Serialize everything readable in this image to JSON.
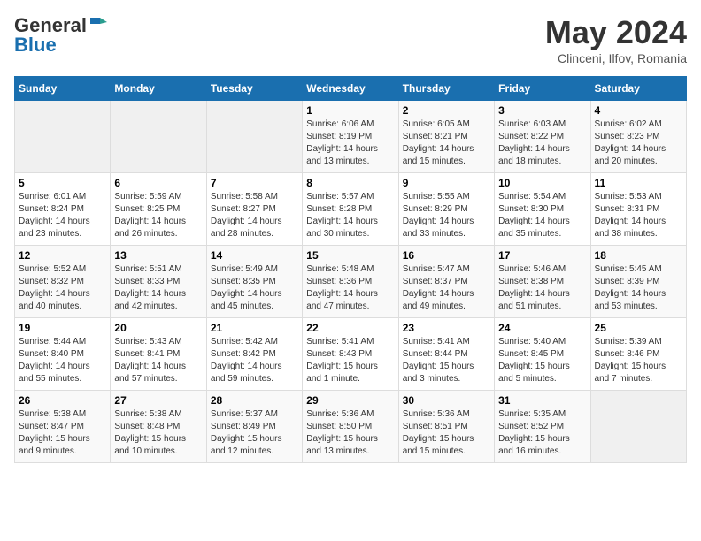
{
  "header": {
    "logo_general": "General",
    "logo_blue": "Blue",
    "title": "May 2024",
    "location": "Clinceni, Ilfov, Romania"
  },
  "weekdays": [
    "Sunday",
    "Monday",
    "Tuesday",
    "Wednesday",
    "Thursday",
    "Friday",
    "Saturday"
  ],
  "weeks": [
    [
      {
        "day": "",
        "content": ""
      },
      {
        "day": "",
        "content": ""
      },
      {
        "day": "",
        "content": ""
      },
      {
        "day": "1",
        "content": "Sunrise: 6:06 AM\nSunset: 8:19 PM\nDaylight: 14 hours\nand 13 minutes."
      },
      {
        "day": "2",
        "content": "Sunrise: 6:05 AM\nSunset: 8:21 PM\nDaylight: 14 hours\nand 15 minutes."
      },
      {
        "day": "3",
        "content": "Sunrise: 6:03 AM\nSunset: 8:22 PM\nDaylight: 14 hours\nand 18 minutes."
      },
      {
        "day": "4",
        "content": "Sunrise: 6:02 AM\nSunset: 8:23 PM\nDaylight: 14 hours\nand 20 minutes."
      }
    ],
    [
      {
        "day": "5",
        "content": "Sunrise: 6:01 AM\nSunset: 8:24 PM\nDaylight: 14 hours\nand 23 minutes."
      },
      {
        "day": "6",
        "content": "Sunrise: 5:59 AM\nSunset: 8:25 PM\nDaylight: 14 hours\nand 26 minutes."
      },
      {
        "day": "7",
        "content": "Sunrise: 5:58 AM\nSunset: 8:27 PM\nDaylight: 14 hours\nand 28 minutes."
      },
      {
        "day": "8",
        "content": "Sunrise: 5:57 AM\nSunset: 8:28 PM\nDaylight: 14 hours\nand 30 minutes."
      },
      {
        "day": "9",
        "content": "Sunrise: 5:55 AM\nSunset: 8:29 PM\nDaylight: 14 hours\nand 33 minutes."
      },
      {
        "day": "10",
        "content": "Sunrise: 5:54 AM\nSunset: 8:30 PM\nDaylight: 14 hours\nand 35 minutes."
      },
      {
        "day": "11",
        "content": "Sunrise: 5:53 AM\nSunset: 8:31 PM\nDaylight: 14 hours\nand 38 minutes."
      }
    ],
    [
      {
        "day": "12",
        "content": "Sunrise: 5:52 AM\nSunset: 8:32 PM\nDaylight: 14 hours\nand 40 minutes."
      },
      {
        "day": "13",
        "content": "Sunrise: 5:51 AM\nSunset: 8:33 PM\nDaylight: 14 hours\nand 42 minutes."
      },
      {
        "day": "14",
        "content": "Sunrise: 5:49 AM\nSunset: 8:35 PM\nDaylight: 14 hours\nand 45 minutes."
      },
      {
        "day": "15",
        "content": "Sunrise: 5:48 AM\nSunset: 8:36 PM\nDaylight: 14 hours\nand 47 minutes."
      },
      {
        "day": "16",
        "content": "Sunrise: 5:47 AM\nSunset: 8:37 PM\nDaylight: 14 hours\nand 49 minutes."
      },
      {
        "day": "17",
        "content": "Sunrise: 5:46 AM\nSunset: 8:38 PM\nDaylight: 14 hours\nand 51 minutes."
      },
      {
        "day": "18",
        "content": "Sunrise: 5:45 AM\nSunset: 8:39 PM\nDaylight: 14 hours\nand 53 minutes."
      }
    ],
    [
      {
        "day": "19",
        "content": "Sunrise: 5:44 AM\nSunset: 8:40 PM\nDaylight: 14 hours\nand 55 minutes."
      },
      {
        "day": "20",
        "content": "Sunrise: 5:43 AM\nSunset: 8:41 PM\nDaylight: 14 hours\nand 57 minutes."
      },
      {
        "day": "21",
        "content": "Sunrise: 5:42 AM\nSunset: 8:42 PM\nDaylight: 14 hours\nand 59 minutes."
      },
      {
        "day": "22",
        "content": "Sunrise: 5:41 AM\nSunset: 8:43 PM\nDaylight: 15 hours\nand 1 minute."
      },
      {
        "day": "23",
        "content": "Sunrise: 5:41 AM\nSunset: 8:44 PM\nDaylight: 15 hours\nand 3 minutes."
      },
      {
        "day": "24",
        "content": "Sunrise: 5:40 AM\nSunset: 8:45 PM\nDaylight: 15 hours\nand 5 minutes."
      },
      {
        "day": "25",
        "content": "Sunrise: 5:39 AM\nSunset: 8:46 PM\nDaylight: 15 hours\nand 7 minutes."
      }
    ],
    [
      {
        "day": "26",
        "content": "Sunrise: 5:38 AM\nSunset: 8:47 PM\nDaylight: 15 hours\nand 9 minutes."
      },
      {
        "day": "27",
        "content": "Sunrise: 5:38 AM\nSunset: 8:48 PM\nDaylight: 15 hours\nand 10 minutes."
      },
      {
        "day": "28",
        "content": "Sunrise: 5:37 AM\nSunset: 8:49 PM\nDaylight: 15 hours\nand 12 minutes."
      },
      {
        "day": "29",
        "content": "Sunrise: 5:36 AM\nSunset: 8:50 PM\nDaylight: 15 hours\nand 13 minutes."
      },
      {
        "day": "30",
        "content": "Sunrise: 5:36 AM\nSunset: 8:51 PM\nDaylight: 15 hours\nand 15 minutes."
      },
      {
        "day": "31",
        "content": "Sunrise: 5:35 AM\nSunset: 8:52 PM\nDaylight: 15 hours\nand 16 minutes."
      },
      {
        "day": "",
        "content": ""
      }
    ]
  ]
}
